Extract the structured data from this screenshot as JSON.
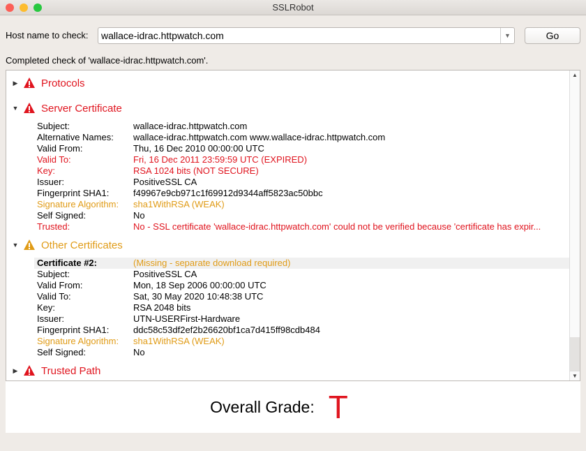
{
  "window": {
    "title": "SSLRobot"
  },
  "host": {
    "label": "Host name to check:",
    "value": "wallace-idrac.httpwatch.com",
    "go_label": "Go"
  },
  "status": "Completed check of 'wallace-idrac.httpwatch.com'.",
  "sections": {
    "protocols": {
      "title": "Protocols",
      "expanded": false,
      "severity": "error"
    },
    "server": {
      "title": "Server Certificate",
      "expanded": true,
      "severity": "error",
      "fields": [
        {
          "k": "Subject:",
          "v": "wallace-idrac.httpwatch.com",
          "s": ""
        },
        {
          "k": "Alternative Names:",
          "v": "wallace-idrac.httpwatch.com www.wallace-idrac.httpwatch.com",
          "s": ""
        },
        {
          "k": "Valid From:",
          "v": "Thu, 16 Dec 2010 00:00:00 UTC",
          "s": ""
        },
        {
          "k": "Valid To:",
          "v": "Fri, 16 Dec 2011 23:59:59 UTC (EXPIRED)",
          "s": "red"
        },
        {
          "k": "Key:",
          "v": "RSA 1024 bits (NOT SECURE)",
          "s": "red"
        },
        {
          "k": "Issuer:",
          "v": "PositiveSSL CA",
          "s": ""
        },
        {
          "k": "Fingerprint SHA1:",
          "v": "f49967e9cb971c1f69912d9344aff5823ac50bbc",
          "s": ""
        },
        {
          "k": "Signature Algorithm:",
          "v": "sha1WithRSA (WEAK)",
          "s": "orange"
        },
        {
          "k": "Self Signed:",
          "v": "No",
          "s": ""
        },
        {
          "k": "Trusted:",
          "v": "No - SSL certificate 'wallace-idrac.httpwatch.com' could not be verified because 'certificate has expir...",
          "s": "red"
        }
      ]
    },
    "other": {
      "title": "Other Certificates",
      "expanded": true,
      "severity": "warning",
      "fields": [
        {
          "k": "Certificate #2:",
          "v": "(Missing - separate download required)",
          "s": "orange"
        },
        {
          "k": "Subject:",
          "v": "PositiveSSL CA",
          "s": ""
        },
        {
          "k": "Valid From:",
          "v": "Mon, 18 Sep 2006 00:00:00 UTC",
          "s": ""
        },
        {
          "k": "Valid To:",
          "v": "Sat, 30 May 2020 10:48:38 UTC",
          "s": ""
        },
        {
          "k": "Key:",
          "v": "RSA 2048 bits",
          "s": ""
        },
        {
          "k": "Issuer:",
          "v": "UTN-USERFirst-Hardware",
          "s": ""
        },
        {
          "k": "Fingerprint SHA1:",
          "v": "ddc58c53df2ef2b26620bf1ca7d415ff98cdb484",
          "s": ""
        },
        {
          "k": "Signature Algorithm:",
          "v": "sha1WithRSA (WEAK)",
          "s": "orange"
        },
        {
          "k": "Self Signed:",
          "v": "No",
          "s": ""
        }
      ]
    },
    "trusted": {
      "title": "Trusted Path",
      "expanded": false,
      "severity": "error"
    }
  },
  "grade": {
    "label": "Overall Grade:",
    "value": "T"
  },
  "colors": {
    "error": "#e0141e",
    "warning": "#e09b16"
  }
}
